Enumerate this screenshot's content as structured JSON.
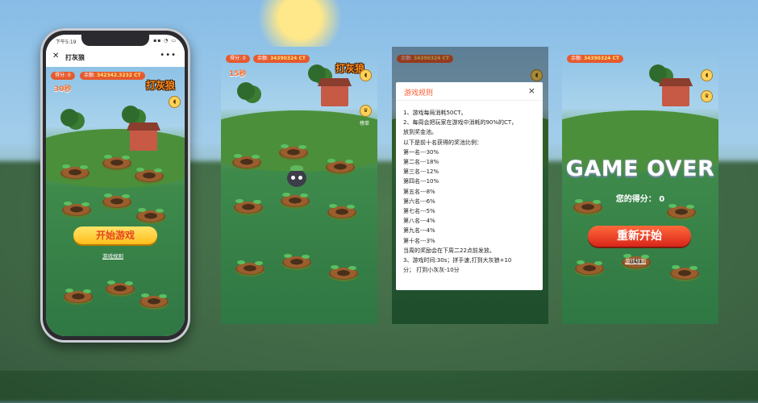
{
  "phone": {
    "status_time": "下午5:19",
    "status_icons": "▪▪ ◔ ▭",
    "nav_close": "✕",
    "nav_title": "打灰狼",
    "nav_more": "•••"
  },
  "hud": {
    "score_label": "得分: 0",
    "balance_label_small": "余额:",
    "balance_small": "342342.3232 CT",
    "balance_label": "余额:",
    "balance": "34390324 CT",
    "timer_small": "30秒",
    "timer": "15秒",
    "logo": "打灰狼",
    "rank_label": "榜单",
    "sound_icon": "speaker-icon",
    "rank_icon": "trophy-icon"
  },
  "start_screen": {
    "start_button": "开始游戏",
    "rules_link": "游戏规则"
  },
  "rules_modal": {
    "title": "游戏规则",
    "close": "×",
    "lines": [
      "1、游戏每局消耗50CT。",
      "2、每周会把玩家在游戏中消耗的90%的CT，",
      "放到奖金池。",
      "以下是前十名获得的奖池比例：",
      "第一名---30%",
      "第二名---18%",
      "第三名---12%",
      "第四名---10%",
      "第五名---8%",
      "第六名---6%",
      "第七名---5%",
      "第八名---4%",
      "第九名---4%",
      "第十名---3%",
      "当周的奖励会在下周二22点前发放。",
      "3、游戏时间:30s；拼手速,打到大灰狼+10",
      "分；  打到小灰灰-10分"
    ]
  },
  "game_over": {
    "title": "GAME OVER",
    "score_text": "您的得分： 0",
    "restart_button": "重新开始",
    "rules_link": "游戏规则"
  }
}
